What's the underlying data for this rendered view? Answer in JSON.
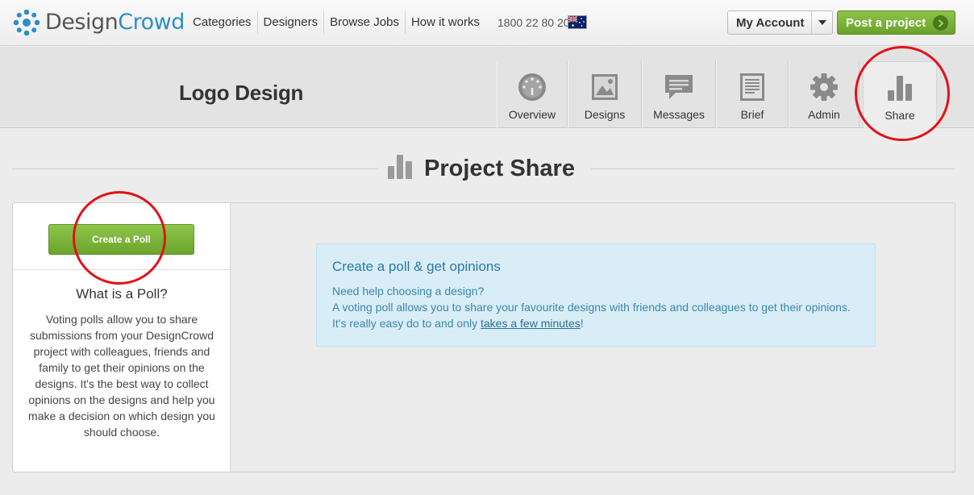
{
  "brand": {
    "name_part1": "Design",
    "name_part2": "Crowd",
    "logo_icon": "asterisk-logo-icon"
  },
  "nav": {
    "links": [
      "Categories",
      "Designers",
      "Browse Jobs",
      "How it works"
    ],
    "phone": "1800 22 80 20",
    "flag_icon": "australia-flag-icon"
  },
  "account": {
    "label": "My Account"
  },
  "post_project": {
    "label": "Post a project"
  },
  "project": {
    "title": "Logo Design",
    "tabs": [
      {
        "label": "Overview",
        "icon": "dashboard-gauge-icon"
      },
      {
        "label": "Designs",
        "icon": "image-icon"
      },
      {
        "label": "Messages",
        "icon": "chat-bubble-icon"
      },
      {
        "label": "Brief",
        "icon": "document-icon"
      },
      {
        "label": "Admin",
        "icon": "gear-icon"
      },
      {
        "label": "Share",
        "icon": "bar-chart-icon"
      }
    ],
    "active_tab": "Share"
  },
  "section": {
    "title": "Project Share",
    "icon": "bar-chart-icon"
  },
  "sidebar": {
    "button": "Create a Poll",
    "heading": "What is a Poll?",
    "body": "Voting polls allow you to share submissions from your DesignCrowd project with colleagues, friends and family to get their opinions on the designs. It's the best way to collect opinions on the designs and help you make a decision on which design you should choose."
  },
  "info": {
    "title": "Create a poll & get opinions",
    "line1": "Need help choosing a design?",
    "line2": "A voting poll allows you to share your favourite designs with friends and colleagues to get their opinions.",
    "line3_prefix": "It's really easy do to and only ",
    "line3_link": "takes a few minutes",
    "line3_suffix": "!"
  },
  "colors": {
    "brand_blue": "#2b8fc8",
    "green_button": "#7ab73a",
    "info_bg": "#d9edf7",
    "annotation_red": "#e0121b"
  }
}
